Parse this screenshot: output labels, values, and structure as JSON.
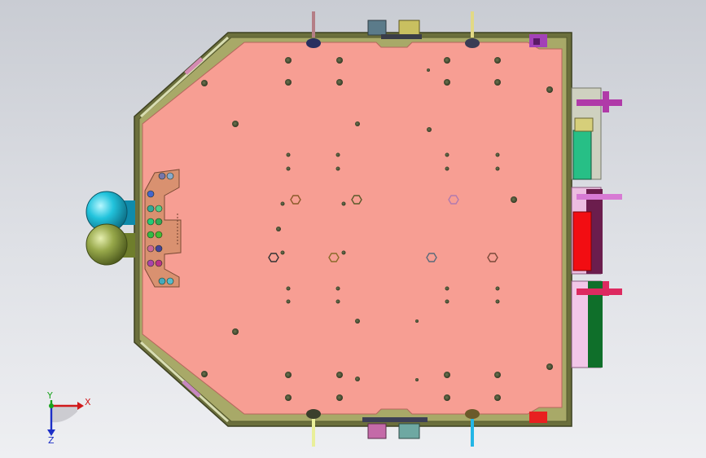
{
  "view": {
    "background_top": "#c9ccd3",
    "background_bottom": "#eeeff2",
    "plate_color": "#f79e93",
    "frame_color": "#6b6f3c"
  },
  "triad": {
    "x_label": "X",
    "y_label": "Y",
    "z_label": "Z",
    "x_color": "#d0191b",
    "y_color": "#18a31c",
    "z_color": "#1c2fc7"
  },
  "icons": [
    "coordinate-triad-icon"
  ]
}
